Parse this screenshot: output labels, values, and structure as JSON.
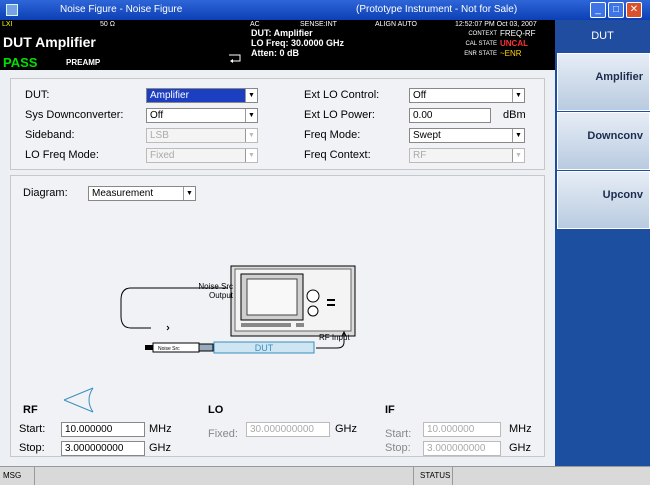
{
  "window": {
    "title": "Noise Figure - Noise Figure",
    "subtitle": "(Prototype Instrument - Not for Sale)"
  },
  "status": {
    "impedance": "50 Ω",
    "coupling": "AC",
    "sense": "SENSE:INT",
    "align": "ALIGN AUTO",
    "datetime": "12:52:07 PM Oct 03, 2007",
    "measurement": "DUT Amplifier",
    "pass": "PASS",
    "preamp": "PREAMP",
    "dut_line": "DUT: Amplifier",
    "lo_line": "LO Freq: 30.0000 GHz",
    "atten_line": "Atten: 0 dB",
    "context_label": "CONTEXT",
    "context_value": "FREQ-RF",
    "cal_label": "CAL STATE",
    "cal_value": "UNCAL",
    "enr_label": "ENR STATE",
    "enr_value": "~ENR"
  },
  "form": {
    "dut_label": "DUT:",
    "dut_value": "Amplifier",
    "sysdown_label": "Sys Downconverter:",
    "sysdown_value": "Off",
    "sideband_label": "Sideband:",
    "sideband_value": "LSB",
    "lomode_label": "LO Freq Mode:",
    "lomode_value": "Fixed",
    "extlo_label": "Ext LO Control:",
    "extlo_value": "Off",
    "extlopow_label": "Ext LO Power:",
    "extlopow_value": "0.00",
    "extlopow_unit": "dBm",
    "freqmode_label": "Freq Mode:",
    "freqmode_value": "Swept",
    "freqctx_label": "Freq Context:",
    "freqctx_value": "RF"
  },
  "diagram": {
    "label": "Diagram:",
    "value": "Measurement",
    "noise_src_output": "Noise Src\nOutput",
    "rf_input": "RF Input",
    "noise_src_tag": "Noise Src",
    "dut_text": "DUT"
  },
  "rf": {
    "title": "RF",
    "start_label": "Start:",
    "start_value": "10.000000",
    "start_unit": "MHz",
    "stop_label": "Stop:",
    "stop_value": "3.000000000",
    "stop_unit": "GHz"
  },
  "lo": {
    "title": "LO",
    "fixed_label": "Fixed:",
    "fixed_value": "30.000000000",
    "fixed_unit": "GHz"
  },
  "if": {
    "title": "IF",
    "start_label": "Start:",
    "start_value": "10.000000",
    "start_unit": "MHz",
    "stop_label": "Stop:",
    "stop_value": "3.000000000",
    "stop_unit": "GHz"
  },
  "sidebar": {
    "title": "DUT",
    "keys": [
      "Amplifier",
      "Downconv",
      "Upconv"
    ]
  },
  "bottom": {
    "msg": "MSG",
    "status": "STATUS"
  }
}
